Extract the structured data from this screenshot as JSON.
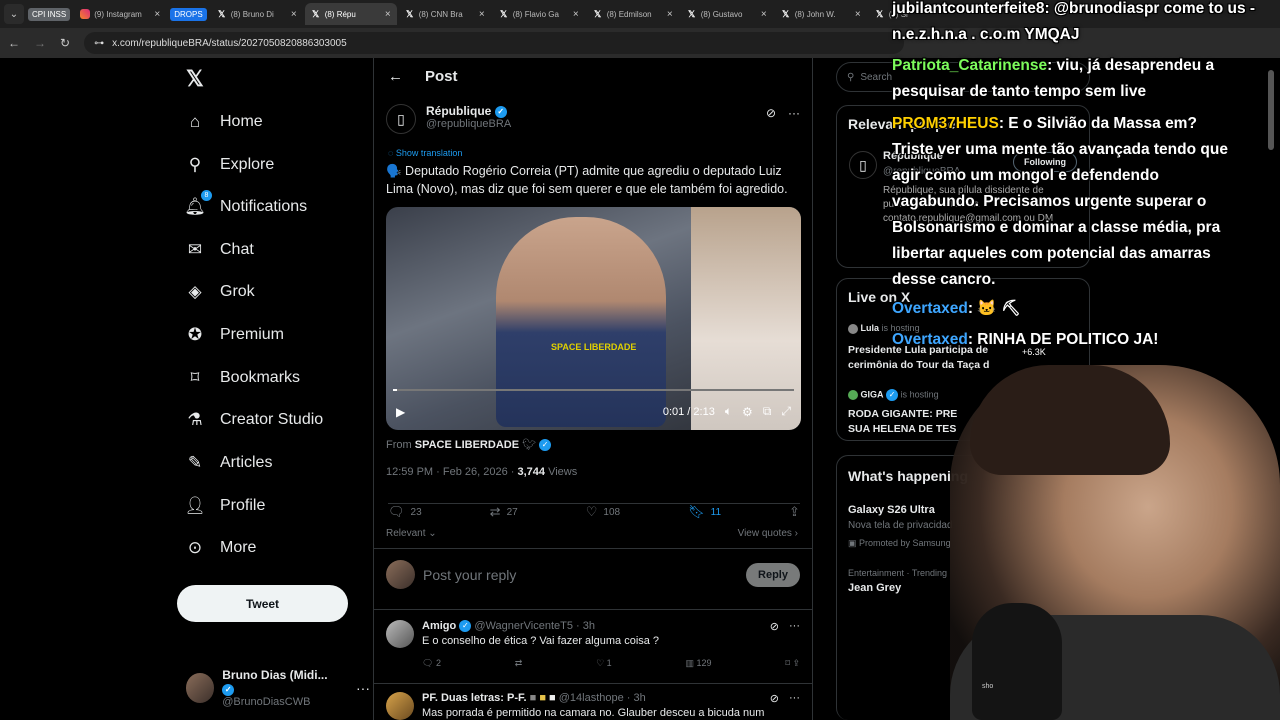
{
  "browser": {
    "tab_pills": [
      "CPI INSS",
      "DROPS"
    ],
    "tabs": [
      {
        "label": "(9) Instagram",
        "icon": "instagram-icon"
      },
      {
        "label": "(8) Bruno Di",
        "icon": "x-icon"
      },
      {
        "label": "(8) Répu",
        "icon": "x-icon",
        "active": true
      },
      {
        "label": "(8) CNN Bra",
        "icon": "x-icon"
      },
      {
        "label": "(8) Flavio Ga",
        "icon": "x-icon"
      },
      {
        "label": "(8) Edmilson",
        "icon": "x-icon"
      },
      {
        "label": "(8) Gustavo",
        "icon": "x-icon"
      },
      {
        "label": "(8) John W.",
        "icon": "x-icon"
      },
      {
        "label": "(8) Si",
        "icon": "x-icon"
      }
    ],
    "url": "x.com/republiqueBRA/status/2027050820886303005"
  },
  "nav": {
    "home": "Home",
    "explore": "Explore",
    "notifications": "Notifications",
    "notifications_badge": "8",
    "chat": "Chat",
    "grok": "Grok",
    "premium": "Premium",
    "bookmarks": "Bookmarks",
    "creator_studio": "Creator Studio",
    "articles": "Articles",
    "profile": "Profile",
    "more": "More",
    "tweet_button": "Tweet",
    "user_name": "Bruno Dias (Midi...",
    "user_handle": "@BrunoDiasCWB"
  },
  "post": {
    "header_title": "Post",
    "author_name": "République",
    "author_handle": "@republiqueBRA",
    "show_translation": "Show translation",
    "text": "🗣️ Deputado Rogério Correia (PT) admite que agrediu o deputado Luiz Lima (Novo), mas diz que foi sem querer e que ele também foi agredido.",
    "video_watermark": "SPACE LIBERDADE",
    "video_time": "0:01 / 2:13",
    "video_progress": 0.01,
    "from_label": "From",
    "from_source": "SPACE LIBERDADE",
    "timestamp": "12:59 PM · Feb 26, 2026 ·",
    "views_count": "3,744",
    "views_label": "Views",
    "replies": "23",
    "reposts": "27",
    "likes": "108",
    "bookmarks": "11",
    "sort_label": "Relevant",
    "view_quotes": "View quotes",
    "reply_placeholder": "Post your reply",
    "reply_button": "Reply"
  },
  "replies": [
    {
      "name": "Amigo",
      "handle": "@WagnerVicenteT5 · 3h",
      "text": "E o conselho de ética ? Vai fazer alguma coisa ?",
      "replies": "2",
      "reposts": "",
      "likes": "1",
      "views": "129"
    },
    {
      "name": "PF. Duas letras: P-F.",
      "handle": "@14lasthope · 3h",
      "text": "Mas porrada é permitido na camara no. Glauber desceu a bicuda num"
    }
  ],
  "right": {
    "search_placeholder": "Search",
    "relevant_title": "Relevant people",
    "rp_name": "République",
    "rp_handle": "@republiqueBRA",
    "rp_bio": "République, sua pílula dissidente de publicações fortes via contato.republique@gmail.com ou DM",
    "following": "Following",
    "live_title": "Live on X",
    "live1_host": "Lula",
    "live1_hosting": "is hosting",
    "live1_title": "Presidente Lula participa de cerimônia do Tour da Taça d",
    "live1_count": "+6.3K",
    "live2_host": "GIGA",
    "live2_hosting": "is hosting",
    "live2_title": "RODA GIGANTE: PRE SUA HELENA DE TES",
    "happening_title": "What's happening",
    "trend1_title": "Galaxy S26 Ultra",
    "trend1_sub": "Nova tela de privacidad",
    "trend1_promo": "Promoted by Samsung",
    "trend2_cat": "Entertainment · Trending",
    "trend2_title": "Jean Grey"
  },
  "chat": [
    {
      "user": "jubilantcounterfeite8",
      "user_color": "#ffffff",
      "text": ": @brunodiaspr come to us - n.e.z.h.n.a . c.o.m YMQAJ"
    },
    {
      "user": "Patriota_Catarinense",
      "user_color": "#7dfc5c",
      "text": ": viu, já desaprendeu a pesquisar de tanto tempo sem live"
    },
    {
      "user": "PROM37HEUS",
      "user_color": "#ffd000",
      "text": ": E o Silvião da Massa em?"
    },
    {
      "user": "",
      "user_color": "#ffffff",
      "text": "Triste ver uma mente tão avançada tendo que agir como um mongol e defendendo vagabundo. Precisamos urgente superar o Bolsonarismo e dominar a classe média, pra libertar aqueles com potencial das amarras desse cancro."
    },
    {
      "user": "Overtaxed",
      "user_color": "#3ea6ff",
      "text": ":"
    },
    {
      "user": "Overtaxed",
      "user_color": "#3ea6ff",
      "text": ": RINHA DE POLITICO JA!"
    }
  ],
  "webcam": {
    "mic_brand": "sho"
  }
}
